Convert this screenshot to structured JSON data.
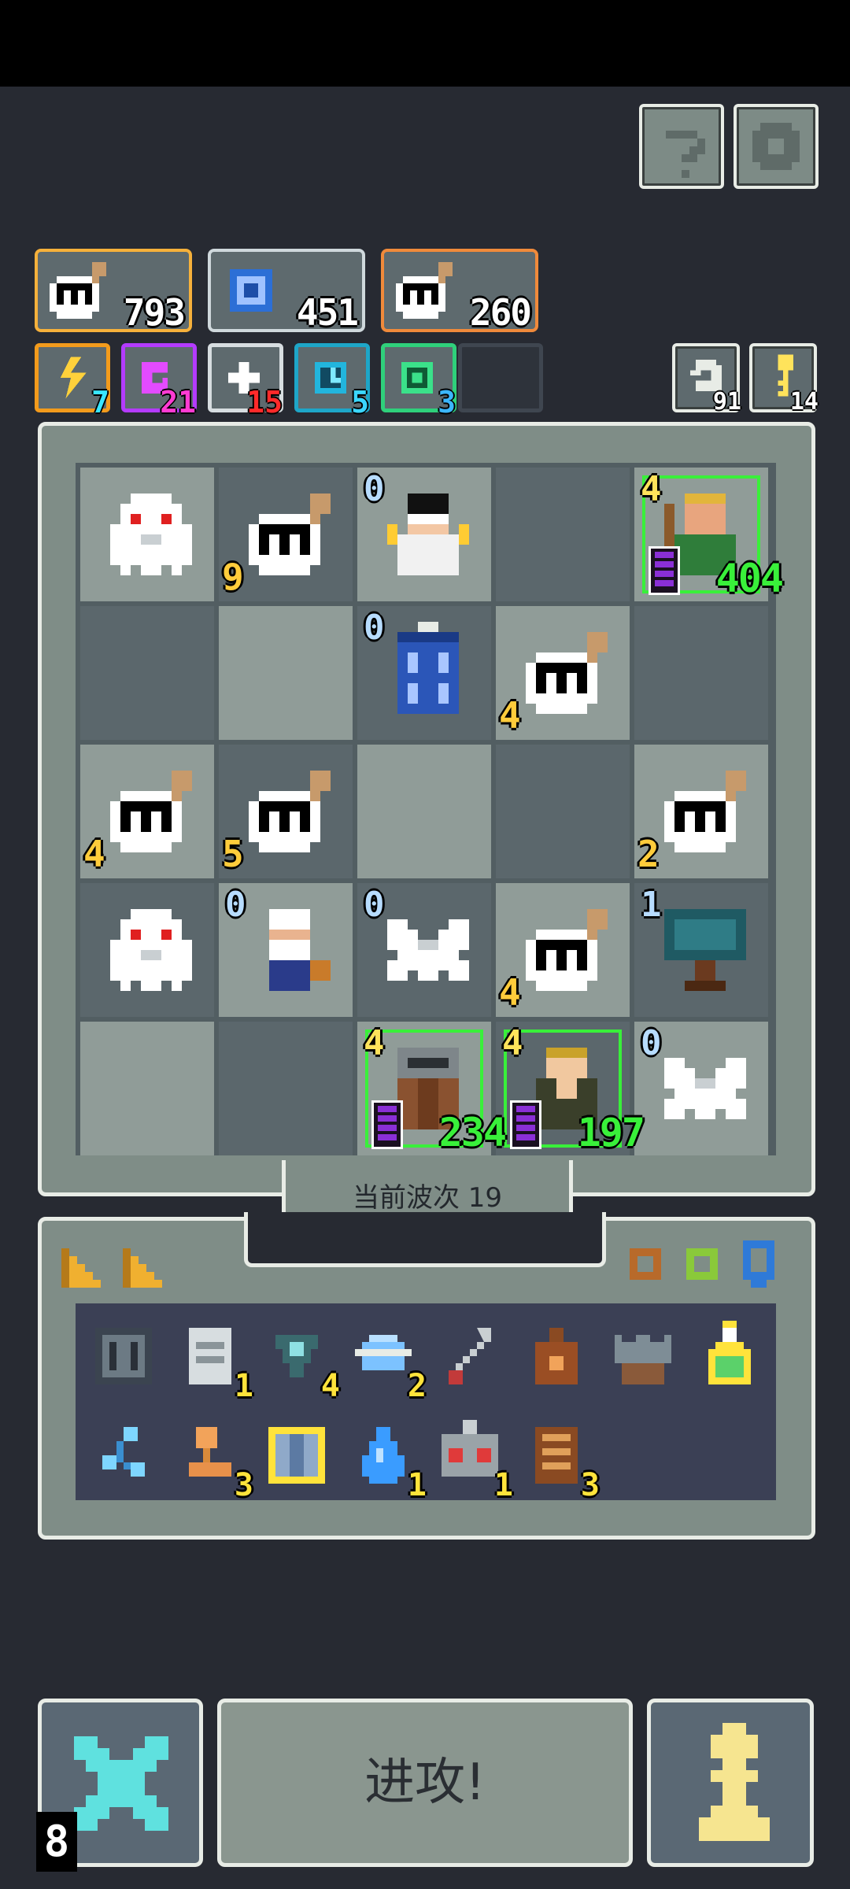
{
  "resources": [
    {
      "icon": "bomb-icon",
      "value": "793",
      "color": "#f6b13b"
    },
    {
      "icon": "vortex-icon",
      "value": "451",
      "color": "#cfd8dc"
    },
    {
      "icon": "bomb-icon",
      "value": "260",
      "color": "#f08a3b"
    }
  ],
  "stats": [
    {
      "icon": "lightning-icon",
      "value": "7",
      "color": "#f39b1c",
      "numcolor": "#39e6ff"
    },
    {
      "icon": "swirl-icon",
      "value": "21",
      "color": "#b43bff",
      "numcolor": "#ff3bd3"
    },
    {
      "icon": "spark-icon",
      "value": "15",
      "color": "#d7dde0",
      "numcolor": "#ff2a2a"
    },
    {
      "icon": "clock-icon",
      "value": "5",
      "color": "#1ea6c8",
      "numcolor": "#3bd6ff"
    },
    {
      "icon": "target-icon",
      "value": "3",
      "color": "#2fd07b",
      "numcolor": "#3bb6ff"
    }
  ],
  "side_counters": [
    {
      "icon": "undo-icon",
      "value": "91"
    },
    {
      "icon": "key-icon",
      "value": "14"
    }
  ],
  "board": {
    "pieces": [
      {
        "row": 0,
        "col": 0,
        "name": "ghost-piece",
        "icon": "ghost-icon"
      },
      {
        "row": 0,
        "col": 1,
        "name": "bomb-piece",
        "icon": "bomb-icon",
        "count": "9"
      },
      {
        "row": 0,
        "col": 2,
        "name": "scientist-piece",
        "icon": "scientist-icon",
        "level": "0"
      },
      {
        "row": 0,
        "col": 4,
        "name": "archer-piece",
        "icon": "archer-icon",
        "level": "4",
        "hp": "404"
      },
      {
        "row": 1,
        "col": 2,
        "name": "police-box-piece",
        "icon": "police-box-icon",
        "level": "0"
      },
      {
        "row": 1,
        "col": 3,
        "name": "bomb-piece",
        "icon": "bomb-icon",
        "count": "4"
      },
      {
        "row": 2,
        "col": 0,
        "name": "bomb-piece",
        "icon": "bomb-icon",
        "count": "4"
      },
      {
        "row": 2,
        "col": 1,
        "name": "bomb-piece",
        "icon": "bomb-icon",
        "count": "5"
      },
      {
        "row": 2,
        "col": 4,
        "name": "bomb-piece",
        "icon": "bomb-icon",
        "count": "2"
      },
      {
        "row": 3,
        "col": 0,
        "name": "ghost-piece",
        "icon": "ghost-icon"
      },
      {
        "row": 3,
        "col": 1,
        "name": "bard-piece",
        "icon": "bard-icon",
        "level": "0"
      },
      {
        "row": 3,
        "col": 2,
        "name": "white-dragon-piece",
        "icon": "dragon-icon",
        "level": "0"
      },
      {
        "row": 3,
        "col": 3,
        "name": "bomb-piece",
        "icon": "bomb-icon",
        "count": "4"
      },
      {
        "row": 3,
        "col": 4,
        "name": "tree-piece",
        "icon": "tree-icon",
        "level": "1"
      },
      {
        "row": 4,
        "col": 2,
        "name": "knight-piece",
        "icon": "knight-icon",
        "level": "4",
        "hp": "234"
      },
      {
        "row": 4,
        "col": 3,
        "name": "soldier-piece",
        "icon": "soldier-icon",
        "level": "4",
        "hp": "197"
      },
      {
        "row": 4,
        "col": 4,
        "name": "white-dragon-piece",
        "icon": "dragon-icon",
        "level": "0"
      }
    ]
  },
  "wave_label": "当前波次 19",
  "tab_icons": [
    "wedge-icon",
    "wedge-icon"
  ],
  "ring_icons": [
    "bronze-ring-icon",
    "green-ring-icon",
    "blue-shield-icon"
  ],
  "inventory": [
    {
      "icon": "grate-icon",
      "count": ""
    },
    {
      "icon": "scroll-icon",
      "count": "1"
    },
    {
      "icon": "gem-icon",
      "count": "4"
    },
    {
      "icon": "planet-icon",
      "count": "2"
    },
    {
      "icon": "wrench-icon",
      "count": ""
    },
    {
      "icon": "bag-icon",
      "count": ""
    },
    {
      "icon": "crown-icon",
      "count": ""
    },
    {
      "icon": "potion-icon",
      "count": ""
    },
    {
      "icon": "molecule-icon",
      "count": ""
    },
    {
      "icon": "stamp-icon",
      "count": "3"
    },
    {
      "icon": "armor-icon",
      "count": ""
    },
    {
      "icon": "drop-icon",
      "count": "1"
    },
    {
      "icon": "robot-icon",
      "count": "1"
    },
    {
      "icon": "book-icon",
      "count": "3"
    }
  ],
  "attack_label": "进攻!",
  "corner_badge": "8"
}
